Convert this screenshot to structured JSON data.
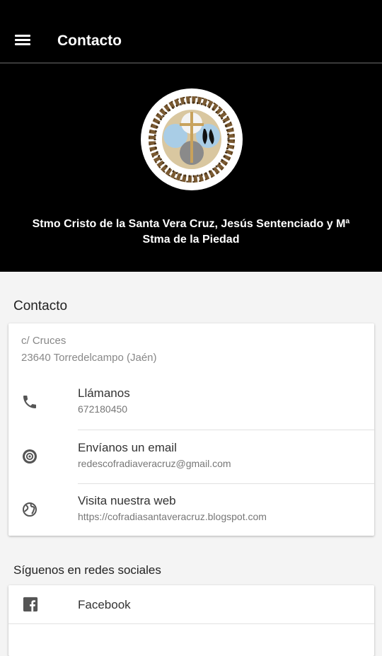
{
  "appbar": {
    "title": "Contacto",
    "menu_icon": "menu-icon"
  },
  "hero": {
    "logo_icon": "brotherhood-crest-icon",
    "title": "Stmo Cristo de la Santa Vera Cruz, Jesús Sentenciado y Mª Stma de la Piedad"
  },
  "contact": {
    "heading": "Contacto",
    "address_line1": "c/ Cruces",
    "address_line2": "23640 Torredelcampo (Jaén)",
    "items": [
      {
        "icon": "phone-icon",
        "label": "Llámanos",
        "value": "672180450"
      },
      {
        "icon": "email-at-icon",
        "label": "Envíanos un email",
        "value": "redescofradiaveracruz@gmail.com"
      },
      {
        "icon": "globe-icon",
        "label": "Visita nuestra web",
        "value": "https://cofradiasantaveracruz.blogspot.com"
      }
    ]
  },
  "social": {
    "heading": "Síguenos en redes sociales",
    "items": [
      {
        "icon": "facebook-icon",
        "label": "Facebook"
      }
    ]
  }
}
